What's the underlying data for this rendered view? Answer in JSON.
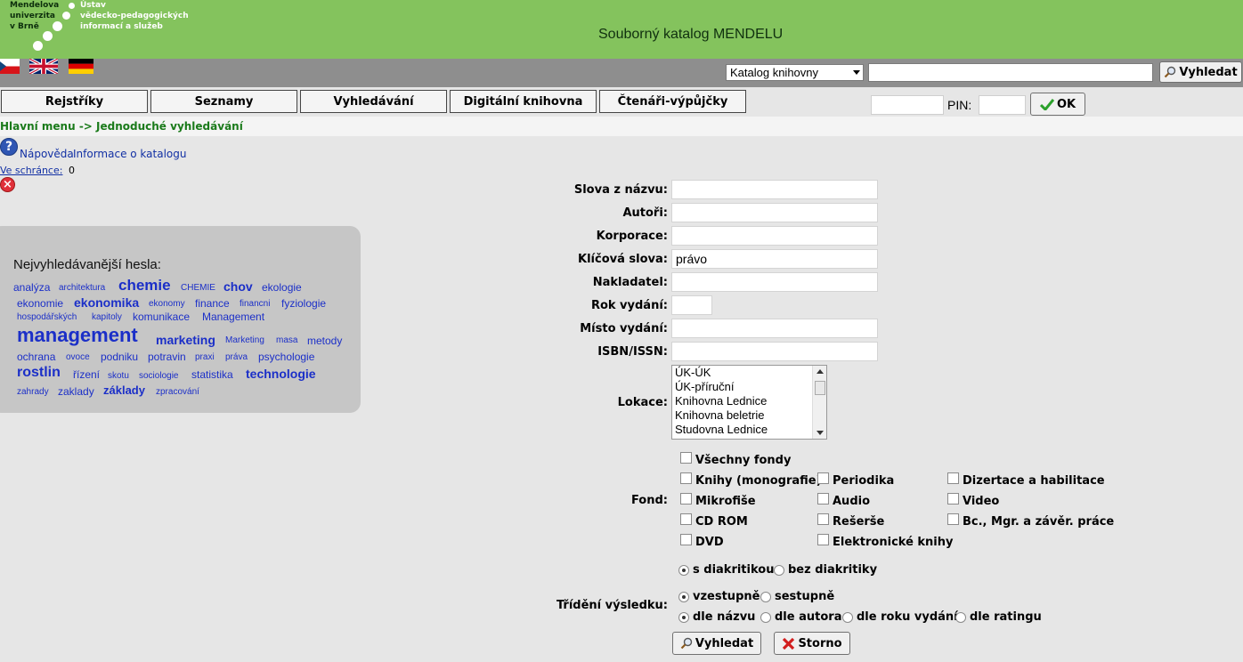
{
  "header": {
    "logo_lines_left": [
      "Mendelova",
      "univerzita",
      "v Brně"
    ],
    "logo_lines_right": [
      "Ústav",
      "vědecko-pedagogických",
      "informací a služeb"
    ],
    "title": "Souborný katalog MENDELU"
  },
  "topbar": {
    "languages": [
      "czech-flag-icon",
      "uk-flag-icon",
      "german-flag-icon"
    ],
    "catalog_select": "Katalog knihovny",
    "search_button": "Vyhledat"
  },
  "nav": {
    "items": [
      "Rejstříky",
      "Seznamy",
      "Vyhledávání",
      "Digitální knihovna",
      "Čtenáři-výpůjčky"
    ],
    "pin_label": "PIN:",
    "ok_label": "OK"
  },
  "breadcrumb": "Hlavní menu -> Jednoduché vyhledávání",
  "sidebar": {
    "help": "Nápověda",
    "info": "Informace o katalogu",
    "cart_label": "Ve schránce:",
    "cart_count": "0"
  },
  "cloud": {
    "title": "Nejvyhledávanější hesla:",
    "tags": [
      "analýza",
      "architektura",
      "chemie",
      "CHEMIE",
      "chov",
      "ekologie",
      "ekonomie",
      "ekonomika",
      "ekonomy",
      "finance",
      "financni",
      "fyziologie",
      "hospodářských",
      "kapitoly",
      "komunikace",
      "Management",
      "management",
      "marketing",
      "Marketing",
      "masa",
      "metody",
      "ochrana",
      "ovoce",
      "podniku",
      "potravin",
      "praxi",
      "práva",
      "psychologie",
      "rostlin",
      "řízení",
      "skotu",
      "sociologie",
      "statistika",
      "technologie",
      "zahrady",
      "zaklady",
      "základy",
      "zpracování"
    ]
  },
  "form": {
    "labels": {
      "title_words": "Slova z názvu:",
      "authors": "Autoři:",
      "corporation": "Korporace:",
      "keywords": "Klíčová slova:",
      "publisher": "Nakladatel:",
      "year": "Rok vydání:",
      "place": "Místo vydání:",
      "isbn": "ISBN/ISSN:",
      "location": "Lokace:",
      "fund": "Fond:",
      "sort": "Třídění výsledku:"
    },
    "values": {
      "title_words": "",
      "authors": "",
      "corporation": "",
      "keywords": "právo",
      "publisher": "",
      "year": "",
      "place": "",
      "isbn": ""
    },
    "locations": [
      "ÚK-ÚK",
      "ÚK-příruční",
      "Knihovna Lednice",
      "Knihovna beletrie",
      "Studovna Lednice"
    ],
    "funds": {
      "all": "Všechny fondy",
      "books": "Knihy (monografie)",
      "periodicals": "Periodika",
      "dissertations": "Dizertace a habilitace",
      "microfiche": "Mikrofiše",
      "audio": "Audio",
      "video": "Video",
      "cdrom": "CD ROM",
      "research": "Rešerše",
      "theses": "Bc., Mgr. a závěr. práce",
      "dvd": "DVD",
      "ebooks": "Elektronické knihy"
    },
    "diacritics": [
      "s diakritikou",
      "bez diakritiky"
    ],
    "order": [
      "vzestupně",
      "sestupně"
    ],
    "sort_by": [
      "dle názvu",
      "dle autora",
      "dle roku vydání",
      "dle ratingu"
    ],
    "search_button": "Vyhledat",
    "cancel_button": "Storno"
  }
}
